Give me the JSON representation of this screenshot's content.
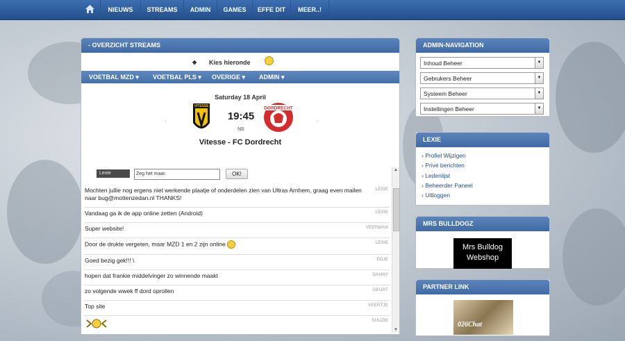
{
  "topnav": {
    "items": [
      "NIEUWS",
      "STREAMS",
      "ADMIN",
      "GAMES",
      "EFFE DIT",
      "MEER..!"
    ]
  },
  "main": {
    "title": "- OVERZICHT STREAMS",
    "kies": "Kies hieronde",
    "subnav": [
      "VOETBAL MZD ▾",
      "VOETBAL PLS ▾",
      "OVERIGE ▾",
      "ADMIN ▾"
    ],
    "match": {
      "date": "Saturday 18 April",
      "time": "19:45",
      "status": "NS",
      "teams": "Vitesse - FC Dordrecht",
      "home_logo_text": "VITESSE",
      "away_logo_text": "DORDRECHT"
    },
    "chat": {
      "name": "Lexie",
      "input_value": "Zeg het maar.",
      "ok_label": "OK!"
    },
    "shouts": [
      {
        "msg": "Mochten jullie nog ergens niet werkende plaatje of onderdelen zien van Ultras Arnhem, graag even mailen naar bug@mottenzedan.nl THANKS!",
        "who": "LEXIE"
      },
      {
        "msg": "Vandaag ga ik de app online zetten (Android)",
        "who": "LEXIE"
      },
      {
        "msg": "Super website!",
        "who": "VEERMAN"
      },
      {
        "msg": "Door de drukte vergeten, maar MZD 1 en 2 zijn online",
        "who": "LEXIE"
      },
      {
        "msg": "Goed bezig gek!!! \\",
        "who": "EDJE"
      },
      {
        "msg": "hopen dat frankie middelvinger zo winnende maakt",
        "who": "DANNY"
      },
      {
        "msg": "zo volgende wwek ff dord oprollen",
        "who": "GEURT"
      },
      {
        "msg": "Top site",
        "who": "VEERTJE"
      },
      {
        "msg": "",
        "who": "SUUZIE"
      }
    ]
  },
  "sidebar": {
    "admin_title": "ADMIN-NAVIGATION",
    "admin_items": [
      "Inhoud Beheer",
      "Gebrukers Beheer",
      "Systeem Beheer",
      "Instellingen Beheer"
    ],
    "user_title": "LEXIE",
    "user_links": [
      "Profiel Wijzigen",
      "Privé berichten",
      "Ledenlijst",
      "Beheerder Paneel",
      "Uitloggen"
    ],
    "bulldog_title": "MRS BULLDOGZ",
    "bulldog_banner_line1": "Mrs Bulldog",
    "bulldog_banner_line2": "Webshop",
    "partner_title": "PARTNER LINK",
    "partner_banner_text": "026Chat"
  },
  "colors": {
    "nav_blue": "#2f5f9e",
    "panel_header": "#4a74ad",
    "link_blue": "#1d4f91"
  }
}
